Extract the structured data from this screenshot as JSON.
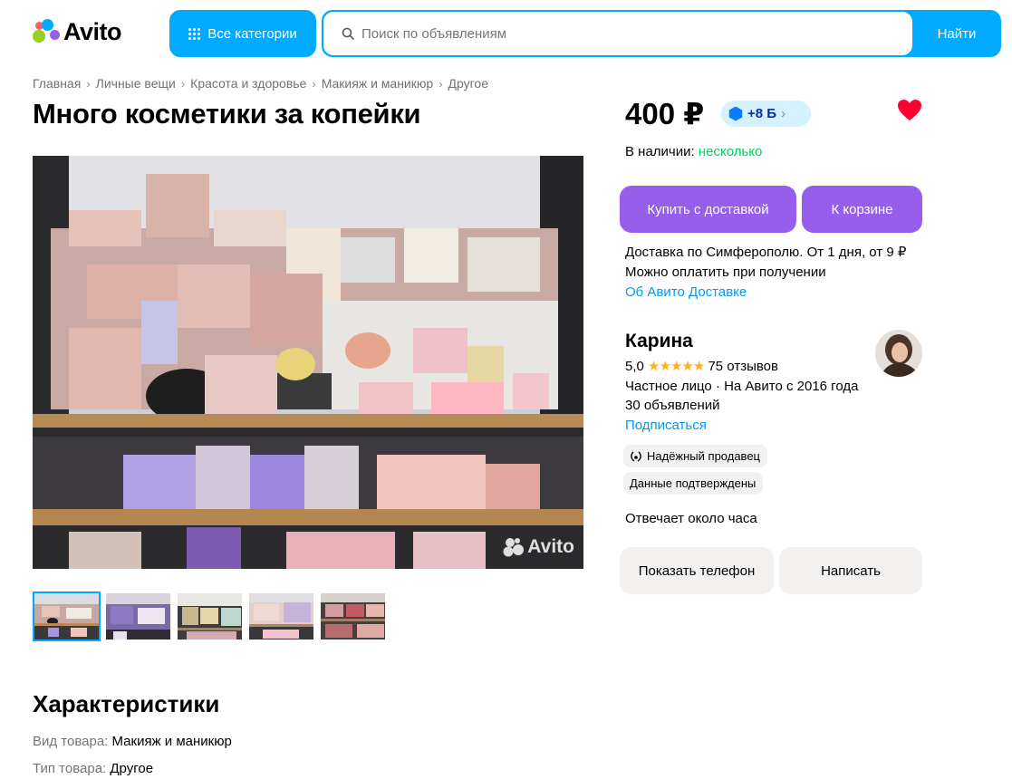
{
  "header": {
    "logo_text": "Avito",
    "categories_label": "Все категории",
    "search_placeholder": "Поиск по объявлениям",
    "search_button": "Найти"
  },
  "breadcrumb": [
    "Главная",
    "Личные вещи",
    "Красота и здоровье",
    "Макияж и маникюр",
    "Другое"
  ],
  "listing": {
    "title": "Много косметики за копейки",
    "price": "400 ₽",
    "bonus": "+8 Б",
    "stock_label": "В наличии:",
    "stock_value": "несколько",
    "watermark": "Avito"
  },
  "actions": {
    "buy_delivery": "Купить с доставкой",
    "to_cart": "К корзине",
    "show_phone": "Показать телефон",
    "write": "Написать"
  },
  "delivery": {
    "line1": "Доставка по Симферополю. От 1 дня, от 9 ₽",
    "line2": "Можно оплатить при получении",
    "link": "Об Авито Доставке"
  },
  "seller": {
    "name": "Карина",
    "rating": "5,0",
    "stars": "★★★★★",
    "reviews": "75 отзывов",
    "type": "Частное лицо · На Авито с 2016 года",
    "ads": "30 объявлений",
    "subscribe": "Подписаться",
    "badge_reliable": "Надёжный продавец",
    "badge_verified": "Данные подтверждены",
    "reply_time": "Отвечает около часа"
  },
  "characteristics": {
    "title": "Характеристики",
    "rows": [
      {
        "key": "Вид товара:",
        "value": "Макияж и маникюр"
      },
      {
        "key": "Тип товара:",
        "value": "Другое"
      }
    ]
  },
  "colors": {
    "accent": "#00aaff",
    "purple": "#965eeb",
    "green": "#02d15c",
    "link": "#0099f7",
    "heart": "#ff0032"
  }
}
